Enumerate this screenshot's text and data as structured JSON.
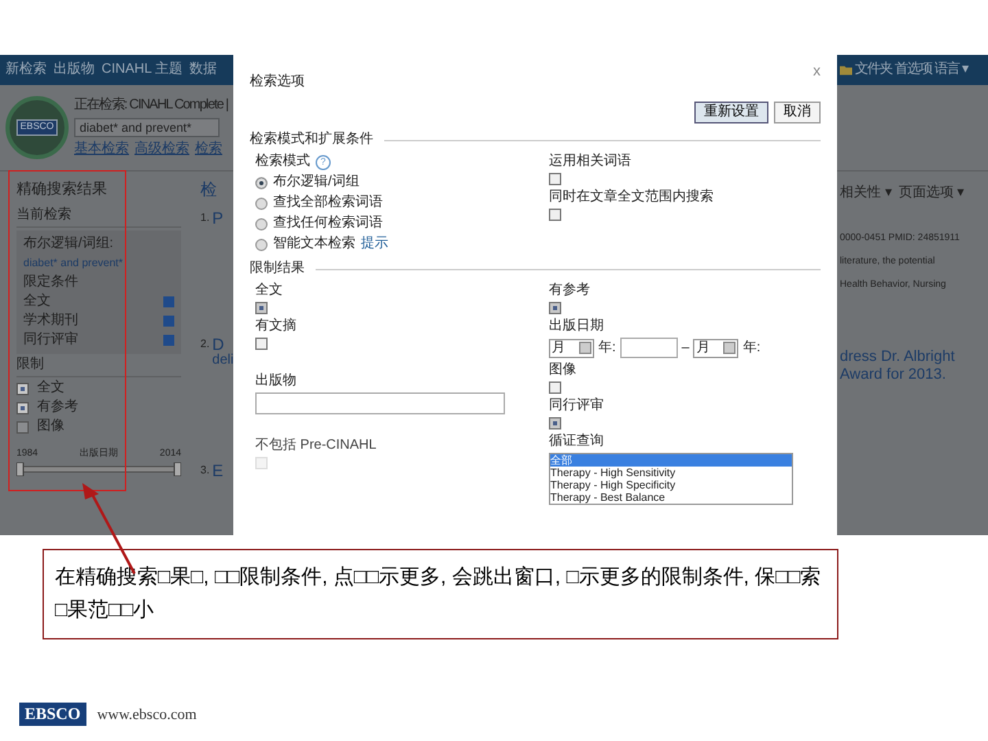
{
  "page": {
    "nav": [
      "新检索",
      "出版物",
      "CINAHL 主题",
      "数据"
    ],
    "nav_right": [
      "文件夹",
      "首选项",
      "语言 ▾"
    ],
    "logo": "EBSCO",
    "search_label": "正在检索: CINAHL Complete |",
    "query": "diabet* and prevent*",
    "search_links": [
      "基本检索",
      "高级检索",
      "检索"
    ],
    "sidebar": {
      "title": "精确搜索结果",
      "current_title": "当前检索",
      "boolean_label": "布尔逻辑/词组:",
      "query": "diabet* and prevent*",
      "limiters_label": "限定条件",
      "limiters": [
        {
          "label": "全文"
        },
        {
          "label": "学术期刊"
        },
        {
          "label": "同行评审"
        }
      ],
      "limit_title": "限制",
      "options": [
        {
          "label": "全文",
          "checked": true
        },
        {
          "label": "有参考",
          "checked": true
        },
        {
          "label": "图像",
          "checked": false
        }
      ],
      "slider": {
        "min": "1984",
        "label": "出版日期",
        "max": "2014"
      }
    },
    "results_heading": "检",
    "results": [
      {
        "number": "1.",
        "title": "P"
      },
      {
        "number": "2.",
        "title": "D",
        "title_2": "deli"
      },
      {
        "number": "3.",
        "title": "E"
      }
    ],
    "toolbar": [
      "相关性 ▾",
      "页面选项 ▾"
    ],
    "snippets": [
      "0000-0451 PMID: 24851911",
      "literature, the potential",
      "Health Behavior, Nursing"
    ],
    "result_title": [
      "dress Dr. Albright",
      "Award for 2013."
    ]
  },
  "dialog": {
    "title": "检索选项",
    "close": "x",
    "buttons": [
      {
        "label": "重新设置",
        "primary": true
      },
      {
        "label": "取消",
        "primary": false
      }
    ],
    "section_1": "检索模式和扩展条件",
    "mode_label": "检索模式",
    "help": "?",
    "modes": [
      {
        "label": "布尔逻辑/词组",
        "selected": true
      },
      {
        "label": "查找全部检索词语",
        "selected": false
      },
      {
        "label": "查找任何检索词语",
        "selected": false
      },
      {
        "label": "智能文本检索",
        "selected": false,
        "link": "提示"
      }
    ],
    "expanders": [
      {
        "label": "运用相关词语",
        "checked": false
      },
      {
        "label": "同时在文章全文范围内搜索",
        "checked": false
      }
    ],
    "section_2": "限制结果",
    "left": [
      {
        "kind": "checkbox",
        "label": "全文",
        "checked": true
      },
      {
        "kind": "checkbox",
        "label": "有文摘",
        "checked": false
      },
      {
        "kind": "text",
        "label": "出版物"
      },
      {
        "kind": "checkbox",
        "label": "不包括 Pre-CINAHL",
        "checked": false,
        "disabled": true
      }
    ],
    "right": [
      {
        "kind": "checkbox",
        "label": "有参考",
        "checked": true
      },
      {
        "kind": "date",
        "label": "出版日期",
        "from": {
          "month": "月",
          "year": "年:"
        },
        "dash": "–",
        "to": {
          "month": "月",
          "year": "年:"
        }
      },
      {
        "kind": "checkbox",
        "label": "图像",
        "checked": false
      },
      {
        "kind": "checkbox",
        "label": "同行评审",
        "checked": true
      },
      {
        "kind": "list",
        "label": "循证查询",
        "options": [
          {
            "label": "全部",
            "selected": true
          },
          {
            "label": "Therapy - High Sensitivity",
            "selected": false
          },
          {
            "label": "Therapy - High Specificity",
            "selected": false
          },
          {
            "label": "Therapy - Best Balance",
            "selected": false
          }
        ]
      }
    ]
  },
  "annotation": {
    "text": "在精确搜索□果□, □□限制条件, 点□□示更多, 会跳出窗口, □示更多的限制条件, 保□□索□果范□□小"
  },
  "footer": {
    "logo": "EBSCO",
    "url": "www.ebsco.com"
  }
}
